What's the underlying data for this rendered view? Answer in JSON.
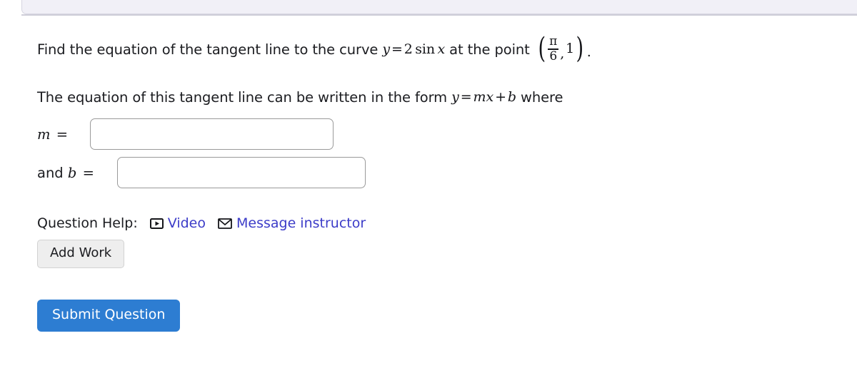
{
  "page": {
    "background_color": "#ffffff",
    "panel_color": "#f1f0f7",
    "link_color": "#3c3cc8",
    "submit_color": "#2d7dd2"
  },
  "question": {
    "line1": {
      "prefix": "Find the equation of the tangent line to the curve",
      "var_y": "y",
      "equals": "=",
      "coefficient": "2",
      "function": "sin",
      "var_x": "x",
      "middle": "at the point",
      "point": {
        "open_paren": "(",
        "numerator": "π",
        "denominator": "6",
        "comma": ",",
        "second_coord": "1",
        "close_paren": ")",
        "period": "."
      }
    },
    "line2": {
      "prefix": "The equation of this tangent line can be written in the form",
      "var_y": "y",
      "equals": "=",
      "slope": "m",
      "var_x": "x",
      "plus": "+",
      "intercept": "b",
      "suffix": "where"
    }
  },
  "answers": [
    {
      "label_prefix": "",
      "variable": "m",
      "equals": "=",
      "value": "",
      "placeholder": ""
    },
    {
      "label_prefix": "and",
      "variable": "b",
      "equals": "=",
      "value": "",
      "placeholder": ""
    }
  ],
  "help": {
    "label": "Question Help:",
    "links": [
      {
        "icon": "video-play-icon",
        "text": "Video"
      },
      {
        "icon": "envelope-icon",
        "text": "Message instructor"
      }
    ]
  },
  "buttons": {
    "add_work": "Add Work",
    "submit": "Submit Question"
  }
}
